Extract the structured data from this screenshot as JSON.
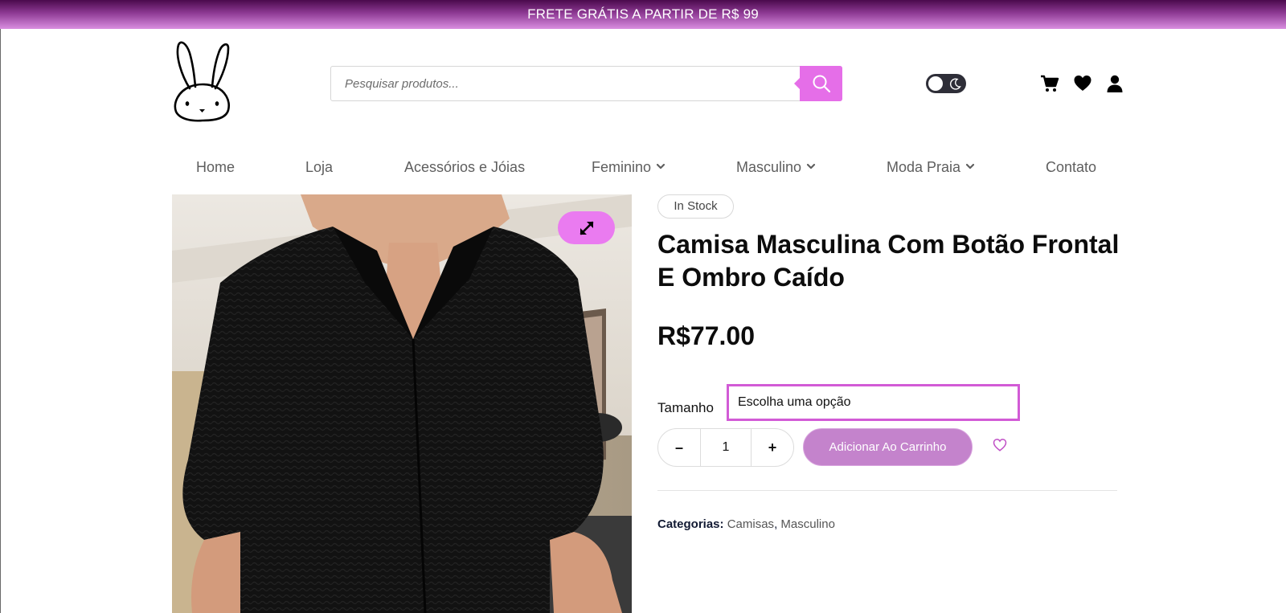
{
  "announcement": {
    "text": "FRETE GRÁTIS A PARTIR DE R$ 99"
  },
  "header": {
    "logo_icon": "bunny-logo-icon",
    "search": {
      "placeholder": "Pesquisar produtos...",
      "value": "",
      "button_icon": "search-icon"
    },
    "theme_toggle": {
      "state": "light",
      "icon": "moon-icon"
    },
    "icons": [
      "cart-icon",
      "heart-icon",
      "user-icon"
    ]
  },
  "nav": {
    "items": [
      {
        "label": "Home",
        "dropdown": false
      },
      {
        "label": "Loja",
        "dropdown": false
      },
      {
        "label": "Acessórios e Jóias",
        "dropdown": false
      },
      {
        "label": "Feminino",
        "dropdown": true
      },
      {
        "label": "Masculino",
        "dropdown": true
      },
      {
        "label": "Moda Praia",
        "dropdown": true
      },
      {
        "label": "Contato",
        "dropdown": false
      }
    ]
  },
  "product": {
    "image_icon": "expand-icon",
    "stock": "In Stock",
    "title": "Camisa Masculina Com Botão Frontal E Ombro Caído",
    "price": "R$77.00",
    "size": {
      "label": "Tamanho",
      "selected": "Escolha uma opção"
    },
    "quantity": {
      "minus": "–",
      "value": "1",
      "plus": "+"
    },
    "add_to_cart": "Adicionar Ao Carrinho",
    "wishlist_icon": "heart-outline-icon",
    "categories": {
      "label": "Categorias:",
      "items": [
        "Camisas",
        "Masculino"
      ]
    }
  },
  "colors": {
    "accent": "#e56ee8",
    "topbar_dark": "#4a0a4c",
    "topbar_light": "#d98ee0",
    "button": "#c483cc",
    "select_border": "#d25bd6"
  }
}
